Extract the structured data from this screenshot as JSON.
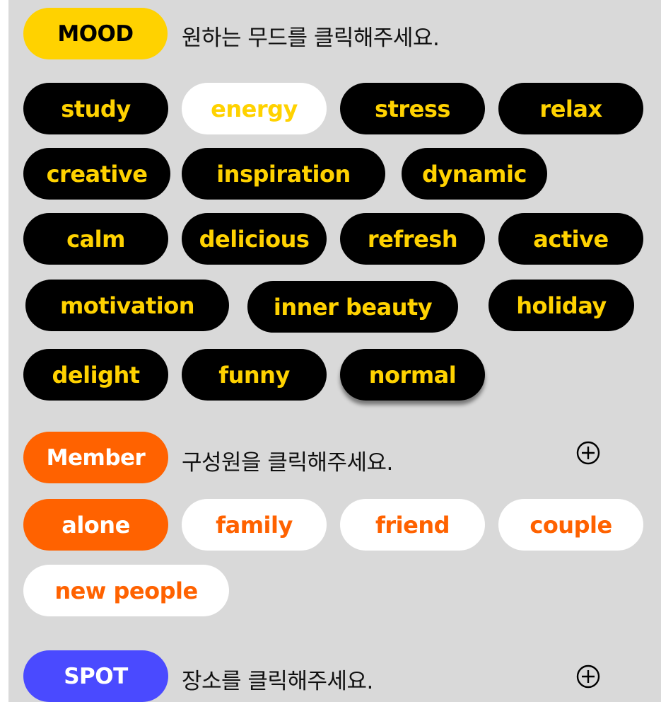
{
  "colors": {
    "background": "#d9d9d9",
    "mood_accent": "#ffd200",
    "member_accent": "#ff6200",
    "spot_accent": "#4a4aff"
  },
  "mood": {
    "label": "MOOD",
    "instruction": "원하는 무드를 클릭해주세요.",
    "chips": [
      {
        "label": "study",
        "selected": false
      },
      {
        "label": "energy",
        "selected": true
      },
      {
        "label": "stress",
        "selected": false
      },
      {
        "label": "relax",
        "selected": false
      },
      {
        "label": "creative",
        "selected": false
      },
      {
        "label": "inspiration",
        "selected": false
      },
      {
        "label": "dynamic",
        "selected": false
      },
      {
        "label": "calm",
        "selected": false
      },
      {
        "label": "delicious",
        "selected": false
      },
      {
        "label": "refresh",
        "selected": false
      },
      {
        "label": "active",
        "selected": false
      },
      {
        "label": "motivation",
        "selected": false
      },
      {
        "label": "inner beauty",
        "selected": false
      },
      {
        "label": "holiday",
        "selected": false
      },
      {
        "label": "delight",
        "selected": false
      },
      {
        "label": "funny",
        "selected": false
      },
      {
        "label": "normal",
        "selected": false
      }
    ]
  },
  "member": {
    "label": "Member",
    "instruction": "구성원을 클릭해주세요.",
    "add_icon": "plus-circle-icon",
    "chips": [
      {
        "label": "alone",
        "selected": true
      },
      {
        "label": "family",
        "selected": false
      },
      {
        "label": "friend",
        "selected": false
      },
      {
        "label": "couple",
        "selected": false
      },
      {
        "label": "new people",
        "selected": false
      }
    ]
  },
  "spot": {
    "label": "SPOT",
    "instruction": "장소를 클릭해주세요.",
    "add_icon": "plus-circle-icon"
  }
}
